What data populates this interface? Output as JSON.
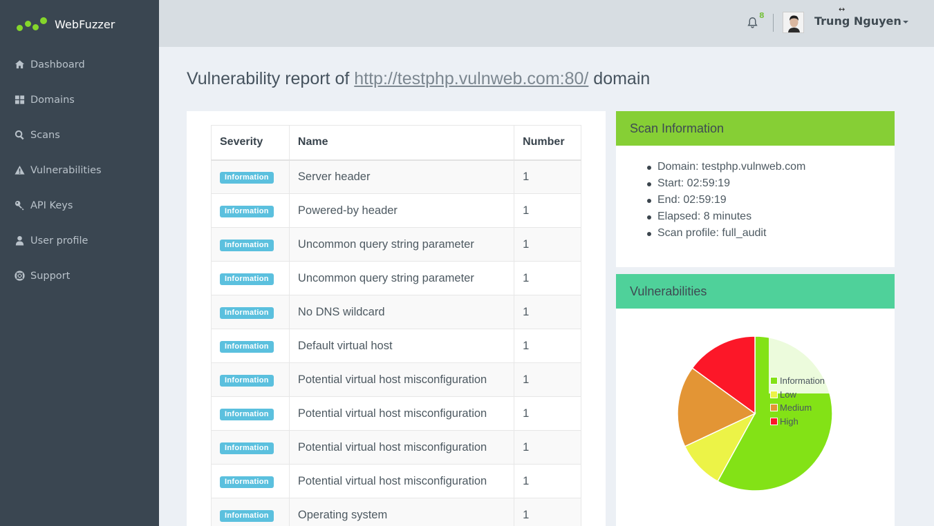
{
  "brand": {
    "name": "WebFuzzer"
  },
  "sidebar": {
    "items": [
      {
        "label": "Dashboard",
        "icon": "home-icon"
      },
      {
        "label": "Domains",
        "icon": "grid-icon"
      },
      {
        "label": "Scans",
        "icon": "search-icon"
      },
      {
        "label": "Vulnerabilities",
        "icon": "warning-icon"
      },
      {
        "label": "API Keys",
        "icon": "key-icon"
      },
      {
        "label": "User profile",
        "icon": "user-icon"
      },
      {
        "label": "Support",
        "icon": "lifebuoy-icon"
      }
    ]
  },
  "header": {
    "notification_count": "8",
    "user_name": "Trung Nguyen",
    "cursor_glyph": "↔"
  },
  "page": {
    "title_prefix": "Vulnerability report of ",
    "domain_link": "http://testphp.vulnweb.com:80/",
    "title_suffix": " domain"
  },
  "table": {
    "headers": {
      "severity": "Severity",
      "name": "Name",
      "number": "Number"
    },
    "rows": [
      {
        "severity": "Information",
        "name": "Server header",
        "number": "1"
      },
      {
        "severity": "Information",
        "name": "Powered-by header",
        "number": "1"
      },
      {
        "severity": "Information",
        "name": "Uncommon query string parameter",
        "number": "1"
      },
      {
        "severity": "Information",
        "name": "Uncommon query string parameter",
        "number": "1"
      },
      {
        "severity": "Information",
        "name": "No DNS wildcard",
        "number": "1"
      },
      {
        "severity": "Information",
        "name": "Default virtual host",
        "number": "1"
      },
      {
        "severity": "Information",
        "name": "Potential virtual host misconfiguration",
        "number": "1"
      },
      {
        "severity": "Information",
        "name": "Potential virtual host misconfiguration",
        "number": "1"
      },
      {
        "severity": "Information",
        "name": "Potential virtual host misconfiguration",
        "number": "1"
      },
      {
        "severity": "Information",
        "name": "Potential virtual host misconfiguration",
        "number": "1"
      },
      {
        "severity": "Information",
        "name": "Operating system",
        "number": "1"
      }
    ]
  },
  "scan_info": {
    "title": "Scan Information",
    "items": [
      "Domain: testphp.vulnweb.com",
      "Start: 02:59:19",
      "End: 02:59:19",
      "Elapsed: 8 minutes",
      "Scan profile: full_audit"
    ]
  },
  "vulnerabilities_panel": {
    "title": "Vulnerabilities"
  },
  "chart_data": {
    "type": "pie",
    "labels": [
      "Information",
      "Low",
      "Medium",
      "High"
    ],
    "values": [
      58,
      10,
      17,
      15
    ],
    "colors": [
      "#83e216",
      "#ecf347",
      "#e39535",
      "#fc1728"
    ],
    "legend_position": "top-right"
  }
}
